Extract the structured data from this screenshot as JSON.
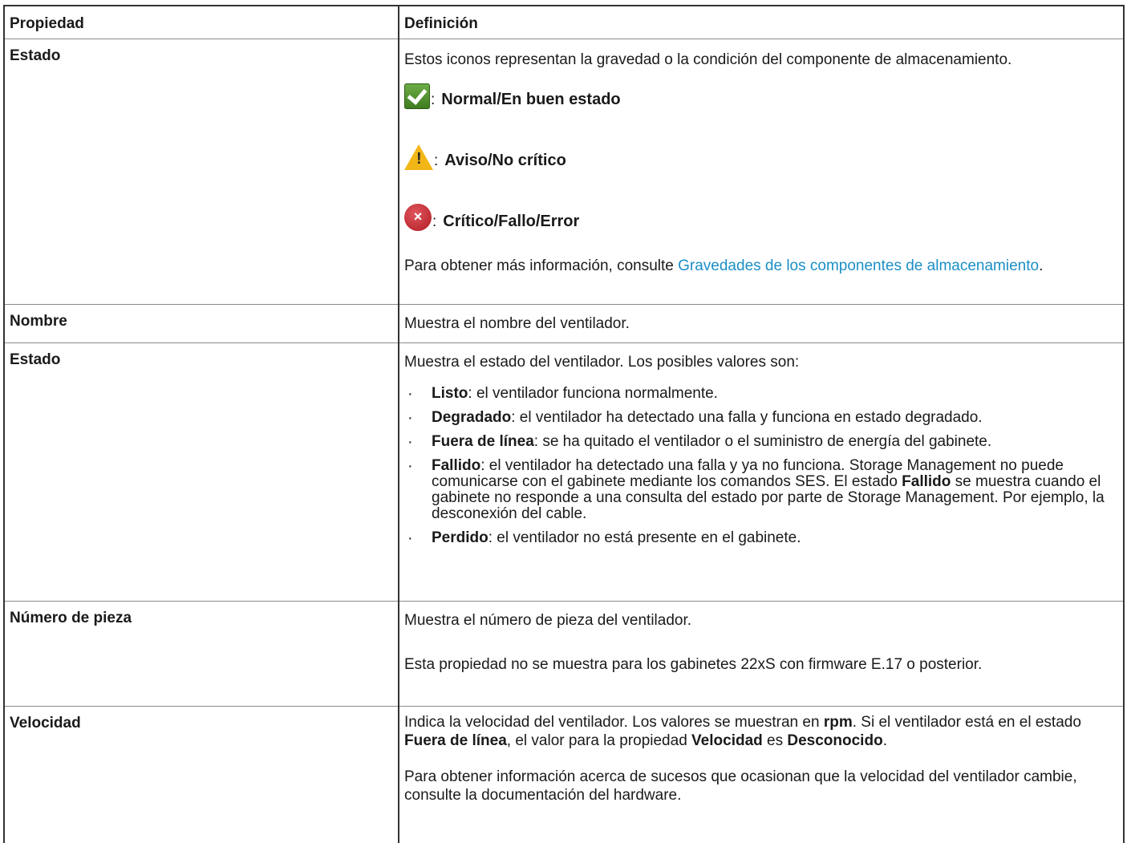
{
  "headers": {
    "property": "Propiedad",
    "definition": "Definición"
  },
  "rows": {
    "status_icon": {
      "property": "Estado",
      "intro": "Estos iconos representan la gravedad o la condición del componente de almacenamiento.",
      "severities": [
        {
          "icon": "check-icon",
          "color": "#4f8f2c",
          "colon": ":",
          "label": "Normal/En buen estado"
        },
        {
          "icon": "warning-icon",
          "color": "#f2b617",
          "colon": ":",
          "label": "Aviso/No crítico"
        },
        {
          "icon": "error-icon",
          "color": "#c0282f",
          "colon": ":",
          "label": "Crítico/Fallo/Error"
        }
      ],
      "more_info_prefix": "Para obtener más información, consulte ",
      "more_info_link": "Gravedades de los componentes de almacenamiento",
      "more_info_suffix": ".",
      "link_color": "#1b8fc6"
    },
    "name": {
      "property": "Nombre",
      "definition": "Muestra el nombre del ventilador."
    },
    "state": {
      "property": "Estado",
      "intro": "Muestra el estado del ventilador. Los posibles valores son:",
      "values": [
        {
          "term": "Listo",
          "text": ": el ventilador funciona normalmente."
        },
        {
          "term": "Degradado",
          "text": ": el ventilador ha detectado una falla y funciona en estado degradado."
        },
        {
          "term": "Fuera de línea",
          "text": ": se ha quitado el ventilador o el suministro de energía del gabinete."
        },
        {
          "term": "Fallido",
          "text": ": el ventilador ha detectado una falla y ya no funciona. Storage Management no puede comunicarse con el gabinete mediante los comandos SES. El estado ",
          "term2": "Fallido",
          "text2": " se muestra cuando el gabinete no responde a una consulta del estado por parte de Storage Management. Por ejemplo, la desconexión del cable."
        },
        {
          "term": "Perdido",
          "text": ": el ventilador no está presente en el gabinete."
        }
      ]
    },
    "part_number": {
      "property": "Número de pieza",
      "definition": "Muestra el número de pieza del ventilador.",
      "note": "Esta propiedad no se muestra para los gabinetes 22xS con firmware E.17 o posterior."
    },
    "speed": {
      "property": "Velocidad",
      "p1_a": "Indica la velocidad del ventilador. Los valores se muestran en ",
      "p1_b": "rpm",
      "p1_c": ". Si el ventilador está en el estado ",
      "p1_d": "Fuera de línea",
      "p1_e": ", el valor para la propiedad ",
      "p1_f": "Velocidad",
      "p1_g": " es ",
      "p1_h": "Desconocido",
      "p1_i": ".",
      "p2": "Para obtener información acerca de sucesos que ocasionan que la velocidad del ventilador cambie, consulte la documentación del hardware."
    }
  }
}
